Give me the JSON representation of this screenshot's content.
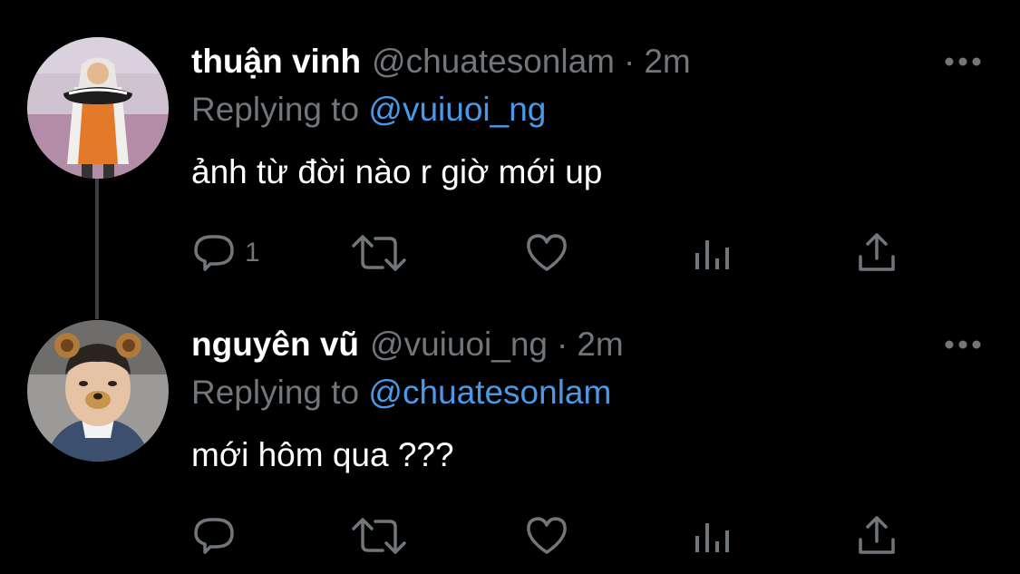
{
  "theme": {
    "background": "#000000",
    "text_primary": "#ffffff",
    "text_secondary": "#71767b",
    "accent": "#4a99e9",
    "thread_line": "#3a3d40"
  },
  "tweets": [
    {
      "display_name": "thuận vinh",
      "handle": "@chuatesonlam",
      "separator": "·",
      "time": "2m",
      "replying_prefix": "Replying to",
      "replying_to": "@vuiuoi_ng",
      "text": "ảnh từ đời nào r giờ mới up",
      "reply_count": "1",
      "avatar_icon": "avatar-photo",
      "actions": [
        "reply-icon",
        "retweet-icon",
        "like-icon",
        "analytics-icon",
        "share-icon"
      ]
    },
    {
      "display_name": "nguyên vũ",
      "handle": "@vuiuoi_ng",
      "separator": "·",
      "time": "2m",
      "replying_prefix": "Replying to",
      "replying_to": "@chuatesonlam",
      "text": "mới hôm qua ???",
      "reply_count": "",
      "avatar_icon": "avatar-photo",
      "actions": [
        "reply-icon",
        "retweet-icon",
        "like-icon",
        "analytics-icon",
        "share-icon"
      ]
    }
  ]
}
